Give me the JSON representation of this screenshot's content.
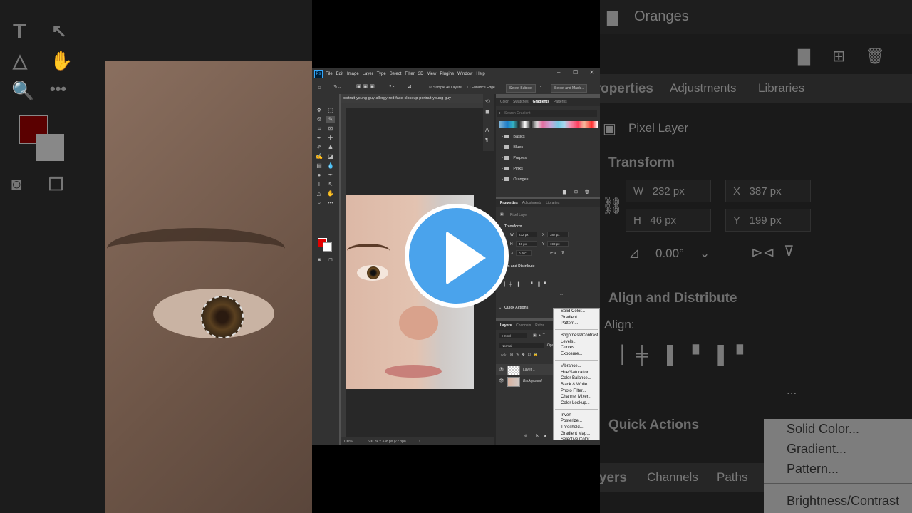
{
  "menubar": [
    "File",
    "Edit",
    "Image",
    "Layer",
    "Type",
    "Select",
    "Filter",
    "3D",
    "View",
    "Plugins",
    "Window",
    "Help"
  ],
  "window_controls": [
    "–",
    "☐",
    "✕"
  ],
  "options_bar": {
    "sample_all_layers": "Sample All Layers",
    "enhance_edge": "Enhance Edge",
    "select_subject": "Select Subject",
    "select_and_mask": "Select and Mask..."
  },
  "document_tab": "portrait-young-guy-allergy-red-face-closeup-portrait-young-guy",
  "status": {
    "zoom": "100%",
    "size": "600 px x 338 px (72 ppi)"
  },
  "gradients_panel": {
    "tabs": [
      "Color",
      "Swatches",
      "Gradients",
      "Patterns"
    ],
    "active_tab": "Gradients",
    "search_placeholder": "Search Gradient",
    "folders": [
      "Basics",
      "Blues",
      "Purples",
      "Pinks",
      "Oranges"
    ]
  },
  "properties_panel": {
    "tabs": [
      "Properties",
      "Adjustments",
      "Libraries"
    ],
    "active_tab": "Properties",
    "layer_type": "Pixel Layer",
    "transform_label": "Transform",
    "w_label": "W",
    "w": "232 px",
    "x_label": "X",
    "x": "387 px",
    "h_label": "H",
    "h": "46 px",
    "y_label": "Y",
    "y": "199 px",
    "angle": "0.00°",
    "align_label": "Align and Distribute",
    "align_short": "ign and Distribute",
    "more": "...",
    "quick_actions": "Quick Actions"
  },
  "layers_panel": {
    "tabs": [
      "Layers",
      "Channels",
      "Paths"
    ],
    "active_tab": "Layers",
    "kind": "Kind",
    "blend_mode": "Normal",
    "opacity_short": "Opa",
    "lock_label": "Lock:",
    "layers": [
      "Layer 1",
      "Background"
    ],
    "fx": "fx"
  },
  "adjustment_menu": {
    "group1": [
      "Solid Color...",
      "Gradient...",
      "Pattern..."
    ],
    "group2": [
      "Brightness/Contrast...",
      "Levels...",
      "Curves...",
      "Exposure..."
    ],
    "group3": [
      "Vibrance...",
      "Hue/Saturation...",
      "Color Balance...",
      "Black & White...",
      "Photo Filter...",
      "Channel Mixer...",
      "Color Lookup..."
    ],
    "group4": [
      "Invert",
      "Posterize...",
      "Threshold...",
      "Gradient Map...",
      "Selective Color..."
    ]
  },
  "background_zoom": {
    "folder_title": "Oranges",
    "tabs": [
      "Properties",
      "Adjustments",
      "Libraries"
    ],
    "layer_type": "Pixel Layer",
    "transform": "Transform",
    "w_label": "W",
    "w": "232 px",
    "x_label": "X",
    "x": "387 px",
    "h_label": "H",
    "h": "46 px",
    "y_label": "Y",
    "y": "199 px",
    "angle": "0.00°",
    "align": "Align and Distribute",
    "align_sub": "Align:",
    "more": "...",
    "quick_actions": "Quick Actions",
    "layers_tabs": [
      "Layers",
      "Channels",
      "Paths"
    ],
    "menu_items": [
      "Solid Color...",
      "Gradient...",
      "Pattern...",
      "Brightness/Contrast"
    ]
  },
  "colors": {
    "foreground": "#e00000",
    "background": "#ffffff",
    "play_button": "#4aa3ec",
    "ps_accent": "#31a8ff"
  }
}
